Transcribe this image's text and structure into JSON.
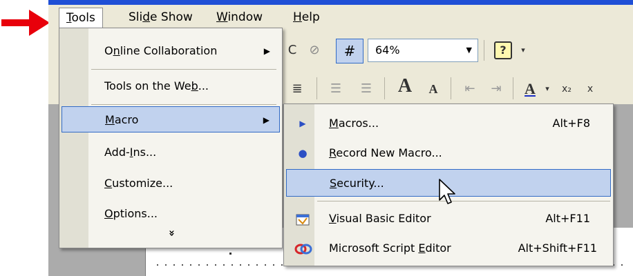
{
  "menubar": {
    "tools": "Tools",
    "slide_show": "Slide Show",
    "window": "Window",
    "help": "Help"
  },
  "toolbar": {
    "zoom_value": "64%"
  },
  "tools_menu": {
    "items": [
      {
        "label": "Online Collaboration",
        "has_submenu": true
      },
      {
        "label": "Tools on the Web...",
        "has_submenu": false
      },
      {
        "label": "Macro",
        "has_submenu": true,
        "selected": true
      },
      {
        "label": "Add-Ins...",
        "has_submenu": false
      },
      {
        "label": "Customize...",
        "has_submenu": false
      },
      {
        "label": "Options...",
        "has_submenu": false
      }
    ],
    "expand": "»"
  },
  "macro_submenu": {
    "items": [
      {
        "label": "Macros...",
        "shortcut": "Alt+F8",
        "icon": "play-triangle-icon"
      },
      {
        "label": "Record New Macro...",
        "shortcut": "",
        "icon": "record-dot-icon"
      },
      {
        "label": "Security...",
        "shortcut": "",
        "icon": "",
        "selected": true
      },
      {
        "label": "Visual Basic Editor",
        "shortcut": "Alt+F11",
        "icon": "visual-basic-editor-icon"
      },
      {
        "label": "Microsoft Script Editor",
        "shortcut": "Alt+Shift+F11",
        "icon": "script-editor-icon"
      }
    ]
  },
  "colors": {
    "selection_fill": "#c1d2ee",
    "selection_border": "#316ac5",
    "arrow_red": "#e8000b",
    "title_blue": "#1f4fd6"
  }
}
